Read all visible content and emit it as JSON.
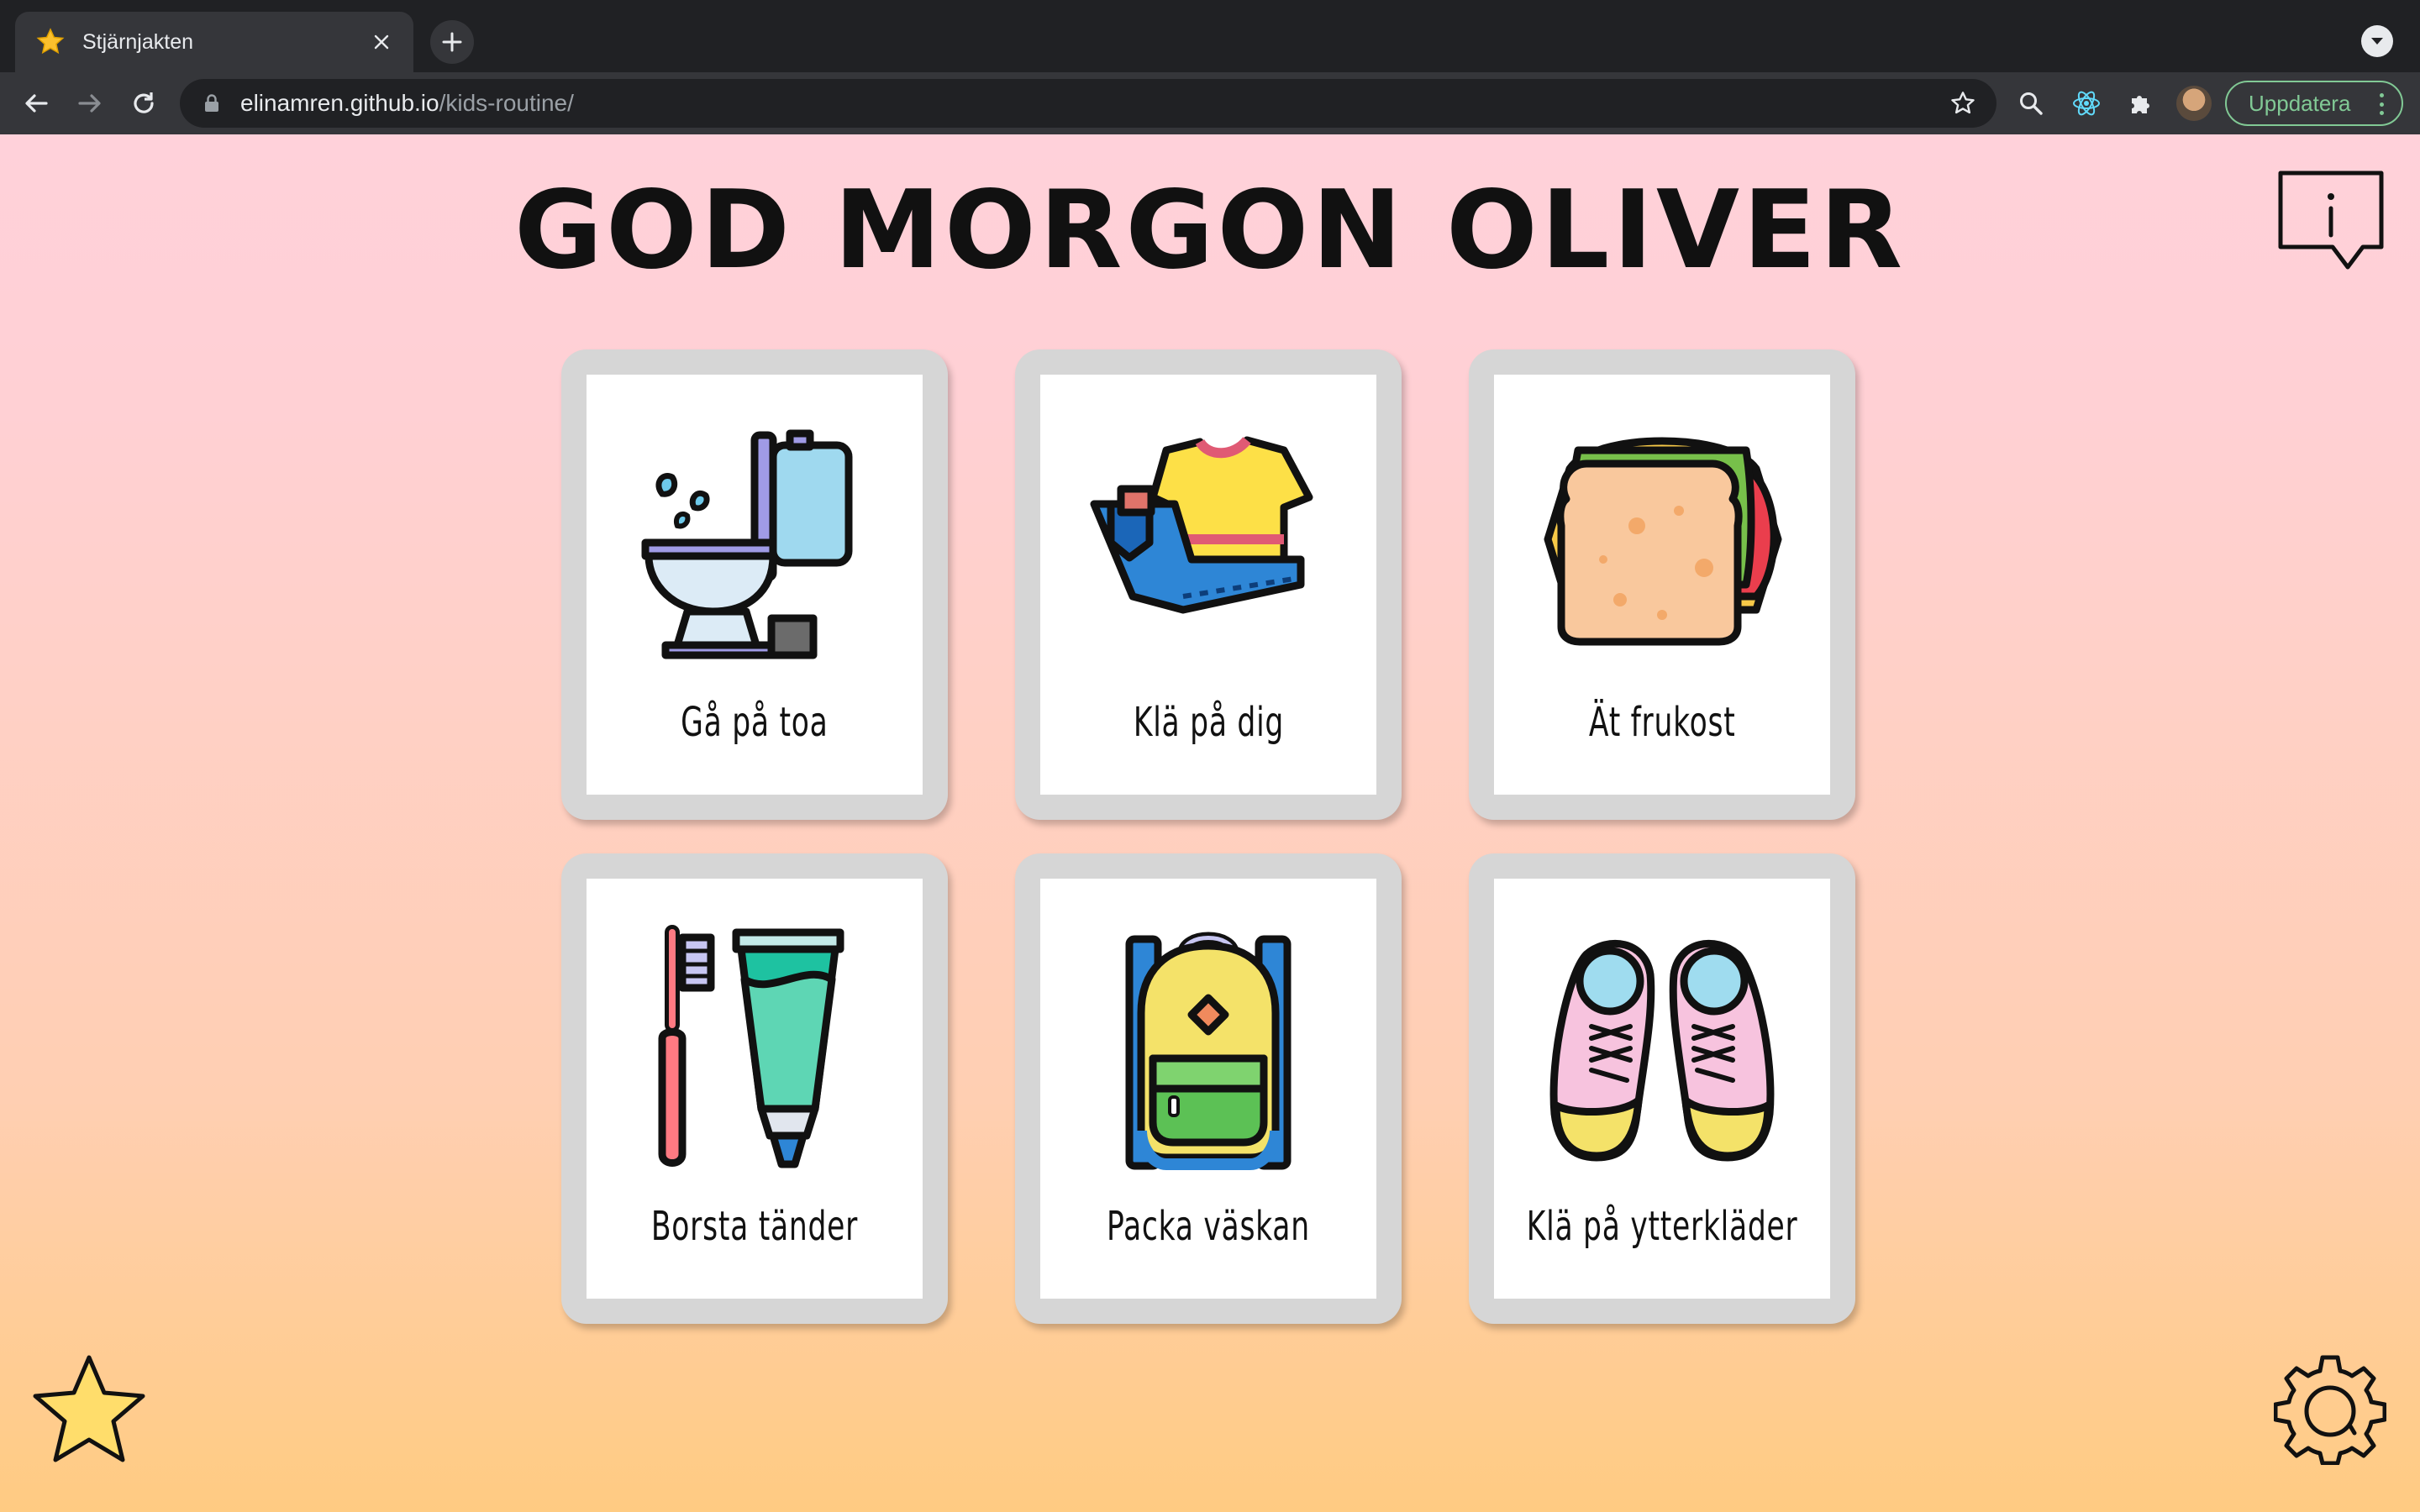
{
  "browser": {
    "tab_title": "Stjärnjakten",
    "url_host": "elinamren.github.io",
    "url_path": "/kids-routine/",
    "update_label": "Uppdatera"
  },
  "page": {
    "title": "GOD MORGON OLIVER",
    "cards": [
      {
        "label": "Gå på toa",
        "icon": "toilet-icon"
      },
      {
        "label": "Klä på dig",
        "icon": "clothes-icon"
      },
      {
        "label": "Ät frukost",
        "icon": "sandwich-icon"
      },
      {
        "label": "Borsta tänder",
        "icon": "toothbrush-icon"
      },
      {
        "label": "Packa väskan",
        "icon": "backpack-icon"
      },
      {
        "label": "Klä på ytterkläder",
        "icon": "shoes-icon"
      }
    ]
  },
  "colors": {
    "background_top": "#ffd1da",
    "background_bottom": "#ffcb82",
    "card_frame": "#d6d6d6",
    "update_green": "#81c995"
  }
}
